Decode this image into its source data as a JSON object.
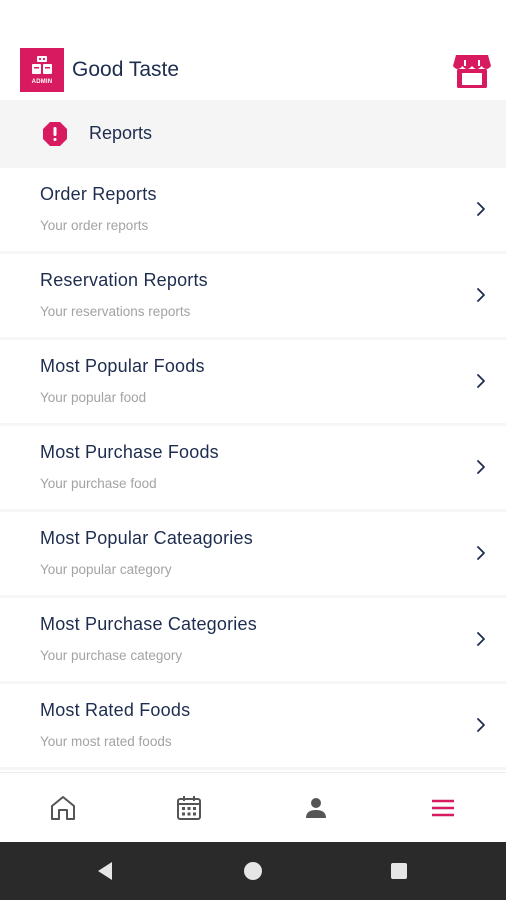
{
  "header": {
    "logo_text": "ADMIN",
    "app_title": "Good Taste",
    "icons": {
      "logo": "admin-logo-icon",
      "store": "store-icon"
    }
  },
  "section": {
    "title": "Reports",
    "icon": "alert-icon"
  },
  "menu": {
    "items": [
      {
        "title": "Order Reports",
        "subtitle": "Your order reports"
      },
      {
        "title": "Reservation Reports",
        "subtitle": "Your reservations reports"
      },
      {
        "title": "Most Popular Foods",
        "subtitle": "Your popular food"
      },
      {
        "title": "Most Purchase Foods",
        "subtitle": "Your purchase food"
      },
      {
        "title": "Most Popular Cateagories",
        "subtitle": "Your popular category"
      },
      {
        "title": "Most Purchase Categories",
        "subtitle": "Your purchase category"
      },
      {
        "title": "Most Rated Foods",
        "subtitle": "Your most rated foods"
      }
    ]
  },
  "bottom_nav": {
    "items": [
      {
        "icon": "home-icon"
      },
      {
        "icon": "calendar-icon"
      },
      {
        "icon": "profile-icon"
      },
      {
        "icon": "menu-icon",
        "active": true
      }
    ]
  },
  "system_nav": {
    "icons": [
      "back-icon",
      "home-circle-icon",
      "recents-icon"
    ]
  },
  "colors": {
    "accent": "#d81b60",
    "title_text": "#1e2d4f",
    "subtitle_text": "#a3a3a3",
    "section_bg": "#f5f5f5",
    "system_bar": "#2a2a2a"
  }
}
